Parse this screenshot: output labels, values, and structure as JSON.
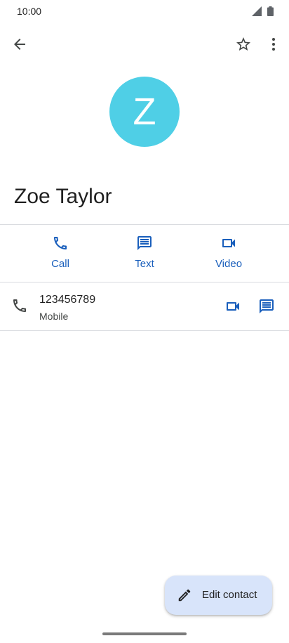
{
  "status_bar": {
    "time": "10:00"
  },
  "top_bar": {
    "back_icon": "arrow-back-icon",
    "star_icon": "star-outline-icon",
    "more_icon": "more-vert-icon"
  },
  "contact": {
    "initial": "Z",
    "avatar_color": "#4fcfe6",
    "name": "Zoe Taylor"
  },
  "actions": [
    {
      "label": "Call",
      "icon": "phone-icon"
    },
    {
      "label": "Text",
      "icon": "message-icon"
    },
    {
      "label": "Video",
      "icon": "videocam-icon"
    }
  ],
  "phone_entry": {
    "number": "123456789",
    "type": "Mobile"
  },
  "fab": {
    "label": "Edit contact",
    "icon": "edit-pencil-icon",
    "background": "#d8e4fa"
  },
  "colors": {
    "accent": "#1a5fbc"
  }
}
